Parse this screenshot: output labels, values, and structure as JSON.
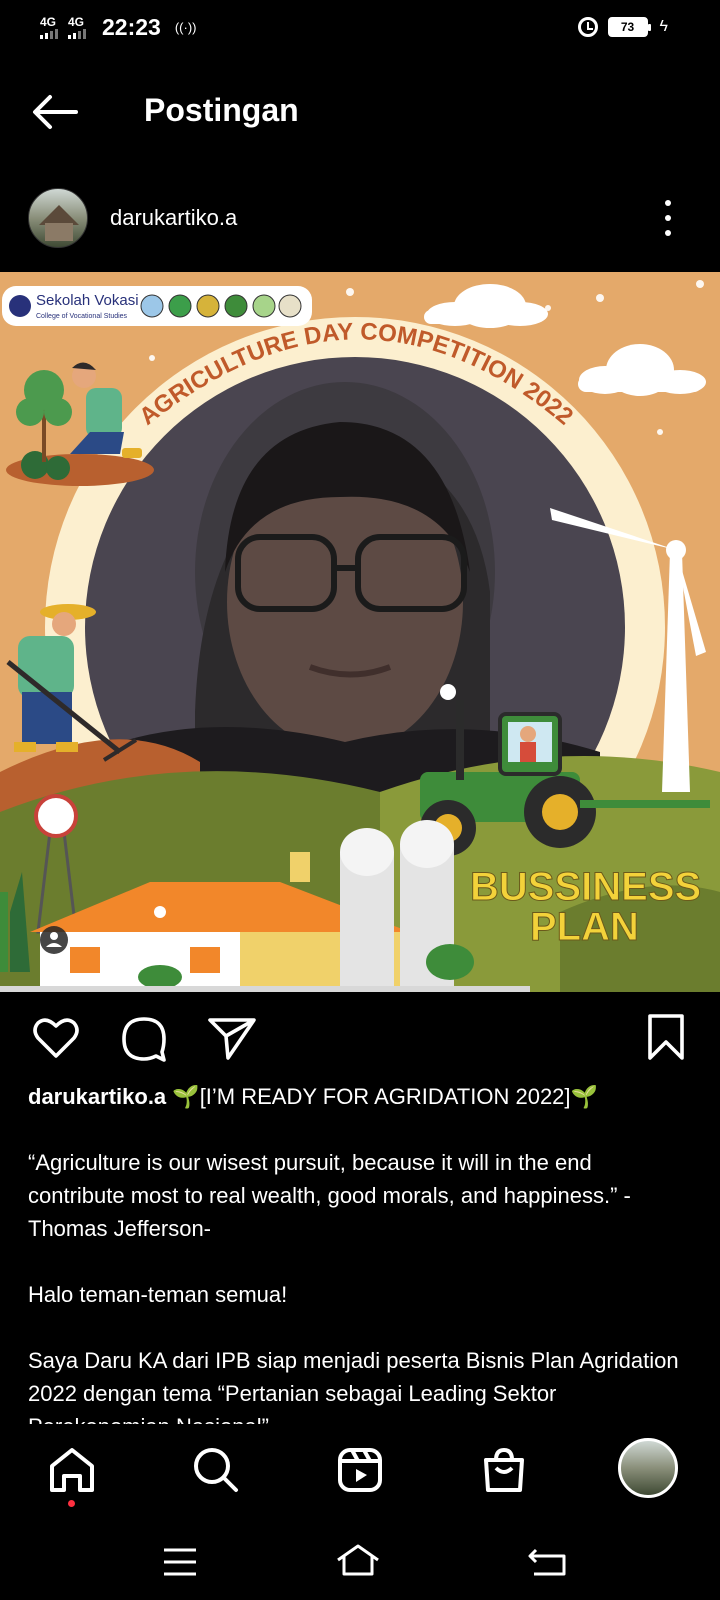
{
  "status_bar": {
    "network1": "4G",
    "network2": "4G",
    "time": "22:23",
    "hotspot": "((·))",
    "battery": "73"
  },
  "header": {
    "title": "Postingan"
  },
  "post": {
    "username": "darukartiko.a",
    "image": {
      "logo_text": "Sekolah Vokasi",
      "logo_sub": "College of Vocational Studies",
      "arc_title": "AGRICULTURE DAY COMPETITION 2022",
      "badge_line1": "BUSSINESS",
      "badge_line2": "PLAN"
    },
    "caption": {
      "username": "darukartiko.a",
      "headline": "🌱[I’M READY FOR AGRIDATION 2022]🌱",
      "quote": "“Agriculture is our wisest pursuit, because it will in the end contribute most to real wealth, good morals, and happiness.” -Thomas Jefferson-",
      "greeting": "Halo teman-teman semua!",
      "body": "Saya Daru KA dari IPB siap menjadi peserta Bisnis Plan Agridation 2022 dengan tema “Pertanian sebagai Leading Sektor Perekonomian Nasional”"
    }
  },
  "colors": {
    "background": "#000000",
    "poster_bg": "#e4a96a",
    "hill_green": "#6b7d2e",
    "badge_yellow": "#f3d23a",
    "like_dot": "#ff3040"
  }
}
